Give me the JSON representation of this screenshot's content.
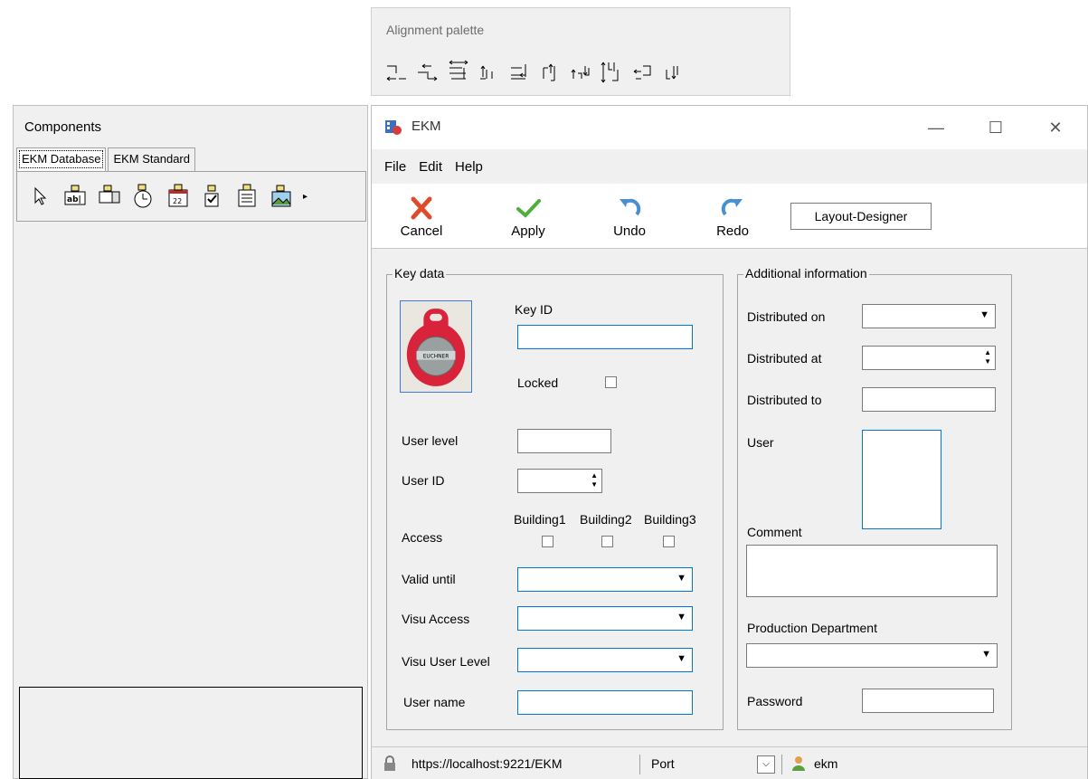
{
  "alignment_palette": {
    "title": "Alignment palette",
    "icons": [
      "align-left-icon",
      "align-right-icon",
      "space-horizontal-icon",
      "align-center-horizontal-icon",
      "align-bottom-icon",
      "align-top-icon",
      "center-vertical-icon",
      "space-vertical-icon",
      "shrink-icon",
      "stretch-icon"
    ]
  },
  "components": {
    "title": "Components",
    "tabs": [
      {
        "label": "EKM Database",
        "active": true
      },
      {
        "label": "EKM Standard",
        "active": false
      }
    ],
    "tools": [
      "pointer-icon",
      "edit-field-icon",
      "combo-box-icon",
      "time-field-icon",
      "date-field-icon",
      "checkbox-icon",
      "memo-icon",
      "image-icon"
    ],
    "more": "▸"
  },
  "window": {
    "title": "EKM",
    "controls": {
      "minimize": "—",
      "maximize": "☐",
      "close": "✕"
    },
    "menu": {
      "file": "File",
      "edit": "Edit",
      "help": "Help"
    },
    "toolbar": {
      "cancel": "Cancel",
      "apply": "Apply",
      "undo": "Undo",
      "redo": "Redo",
      "layout_designer": "Layout-Designer"
    },
    "key_data": {
      "legend": "Key data",
      "key_id_label": "Key ID",
      "key_id_value": "",
      "locked_label": "Locked",
      "user_level_label": "User level",
      "user_id_label": "User ID",
      "access_label": "Access",
      "buildings": [
        "Building1",
        "Building2",
        "Building3"
      ],
      "valid_until_label": "Valid until",
      "visu_access_label": "Visu Access",
      "visu_user_level_label": "Visu User Level",
      "user_name_label": "User name"
    },
    "additional": {
      "legend": "Additional information",
      "distributed_on_label": "Distributed on",
      "distributed_at_label": "Distributed at",
      "distributed_to_label": "Distributed to",
      "user_label": "User",
      "comment_label": "Comment",
      "production_department_label": "Production Department",
      "password_label": "Password"
    },
    "status": {
      "url": "https://localhost:9221/EKM",
      "port_label": "Port",
      "user": "ekm"
    }
  }
}
